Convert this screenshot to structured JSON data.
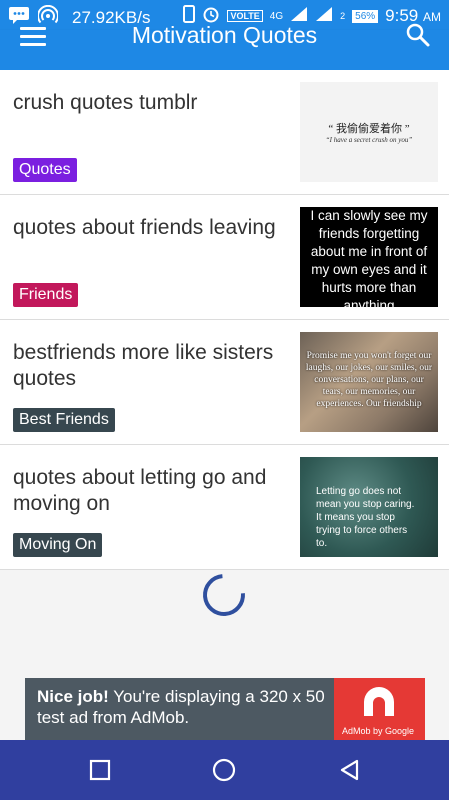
{
  "status": {
    "speed": "27.92KB/s",
    "volte": "VOLTE",
    "network": "4G",
    "sim2": "2",
    "battery": "56%",
    "time": "9:59",
    "ampm": "AM"
  },
  "appbar": {
    "title": "Motivation Quotes"
  },
  "items": [
    {
      "title": "crush quotes tumblr",
      "badge": "Quotes",
      "badge_color": "#7b1fe0",
      "thumb": {
        "line1": "“ 我偷偷爱着你 ”",
        "line2": "“I have a secret crush on you”"
      }
    },
    {
      "title": "quotes about friends leaving",
      "badge": "Friends",
      "badge_color": "#c2185b",
      "thumb": {
        "text": "I can slowly see my friends forgetting about me in front of my own eyes and it hurts more than anything"
      }
    },
    {
      "title": "bestfriends more like sisters quotes",
      "badge": "Best Friends",
      "badge_color": "#37474f",
      "thumb": {
        "text": "Promise me you won't forget our laughs, our jokes, our smiles, our conversations, our plans, our tears, our memories, our experiences. Our friendship"
      }
    },
    {
      "title": "quotes about letting go and moving on",
      "badge": "Moving On",
      "badge_color": "#37474f",
      "thumb": {
        "text": "Letting go does not mean you stop caring. It means you stop trying to force others to."
      }
    }
  ],
  "ad": {
    "bold": "Nice job!",
    "text": " You're displaying a 320 x 50 test ad from AdMob.",
    "brand": "AdMob by Google"
  }
}
